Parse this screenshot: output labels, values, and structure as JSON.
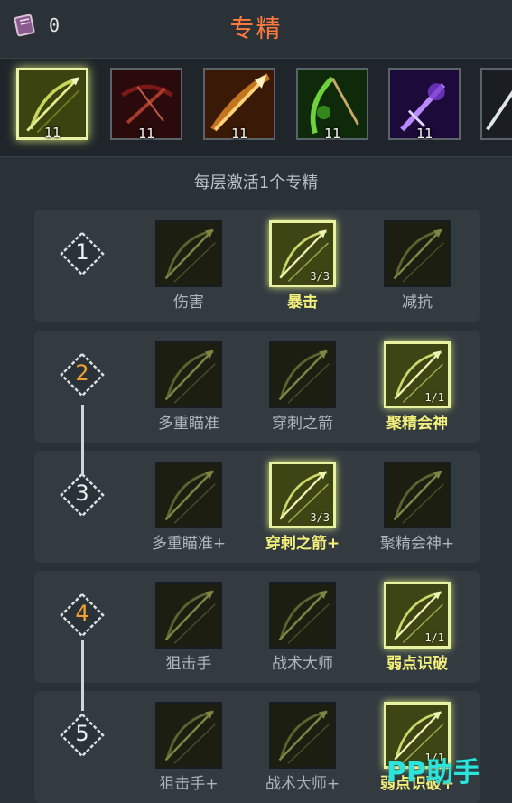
{
  "header": {
    "currency_icon": "skill-book-icon",
    "currency_value": "0",
    "title": "专精"
  },
  "weapons": [
    {
      "name": "bow-spear",
      "icon": "bow-spear-icon",
      "level": "11",
      "selected": true,
      "color": "#9fb02a"
    },
    {
      "name": "crossbow",
      "icon": "crossbow-icon",
      "level": "11",
      "selected": false,
      "color": "#b0302a"
    },
    {
      "name": "fire-arrow",
      "icon": "fire-arrow-icon",
      "level": "11",
      "selected": false,
      "color": "#e07a1a"
    },
    {
      "name": "nature-bow",
      "icon": "nature-bow-icon",
      "level": "11",
      "selected": false,
      "color": "#49b52a"
    },
    {
      "name": "arcane-blade",
      "icon": "arcane-blade-icon",
      "level": "11",
      "selected": false,
      "color": "#7a3ad0"
    }
  ],
  "hint": "每层激活1个专精",
  "tiers": [
    {
      "number": "1",
      "active": false,
      "skills": [
        {
          "label": "伤害",
          "rank": "",
          "active": false
        },
        {
          "label": "暴击",
          "rank": "3/3",
          "active": true
        },
        {
          "label": "减抗",
          "rank": "",
          "active": false
        }
      ]
    },
    {
      "number": "2",
      "active": true,
      "skills": [
        {
          "label": "多重瞄准",
          "rank": "",
          "active": false
        },
        {
          "label": "穿刺之箭",
          "rank": "",
          "active": false
        },
        {
          "label": "聚精会神",
          "rank": "1/1",
          "active": true
        }
      ]
    },
    {
      "number": "3",
      "active": false,
      "skills": [
        {
          "label": "多重瞄准+",
          "rank": "",
          "active": false
        },
        {
          "label": "穿刺之箭+",
          "rank": "3/3",
          "active": true
        },
        {
          "label": "聚精会神+",
          "rank": "",
          "active": false
        }
      ]
    },
    {
      "number": "4",
      "active": true,
      "skills": [
        {
          "label": "狙击手",
          "rank": "",
          "active": false
        },
        {
          "label": "战术大师",
          "rank": "",
          "active": false
        },
        {
          "label": "弱点识破",
          "rank": "1/1",
          "active": true
        }
      ]
    },
    {
      "number": "5",
      "active": false,
      "skills": [
        {
          "label": "狙击手+",
          "rank": "",
          "active": false
        },
        {
          "label": "战术大师+",
          "rank": "",
          "active": false
        },
        {
          "label": "弱点识破+",
          "rank": "1/1",
          "active": true
        }
      ]
    }
  ],
  "watermark": "PP助手",
  "colors": {
    "title": "#ff7a3c",
    "active_label": "#f3f07a",
    "active_tier_number": "#f2a030",
    "background": "#2a3137"
  }
}
